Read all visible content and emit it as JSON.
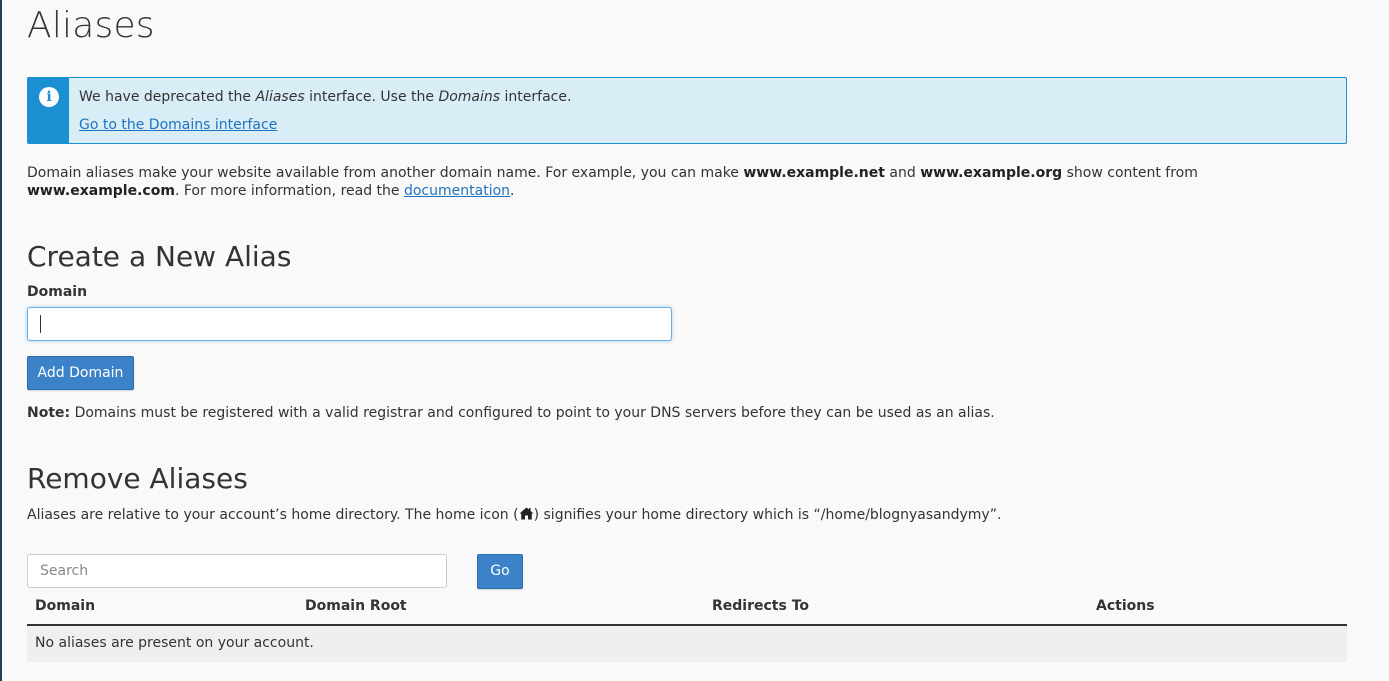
{
  "page": {
    "title": "Aliases"
  },
  "callout": {
    "prefix": "We have deprecated the ",
    "em1": "Aliases",
    "middle": " interface. Use the ",
    "em2": "Domains",
    "suffix": " interface.",
    "link_label": "Go to the Domains interface"
  },
  "intro": {
    "part1": "Domain aliases make your website available from another domain name. For example, you can make ",
    "b1": "www.example.net",
    "part2": " and ",
    "b2": "www.example.org",
    "part3": " show content from ",
    "b3": "www.example.com",
    "part4": ". For more information, read the ",
    "link": "documentation",
    "part5": "."
  },
  "create": {
    "heading": "Create a New Alias",
    "field_label": "Domain",
    "field_value": "",
    "button_label": "Add Domain",
    "note_label": "Note:",
    "note_text": " Domains must be registered with a valid registrar and configured to point to your DNS servers before they can be used as an alias."
  },
  "remove": {
    "heading": "Remove Aliases",
    "desc_before": "Aliases are relative to your account’s home directory. The home icon (",
    "desc_after": ") signifies your home directory which is “/home/blognyasandymy”.",
    "home_icon": "home-icon",
    "search_placeholder": "Search",
    "go_label": "Go"
  },
  "table": {
    "columns": [
      "Domain",
      "Domain Root",
      "Redirects To",
      "Actions"
    ],
    "empty_message": "No aliases are present on your account."
  },
  "colors": {
    "accent": "#3c82c9",
    "info": "#1a8fd1",
    "info_bg": "#d9edf7",
    "link": "#1e73be"
  }
}
